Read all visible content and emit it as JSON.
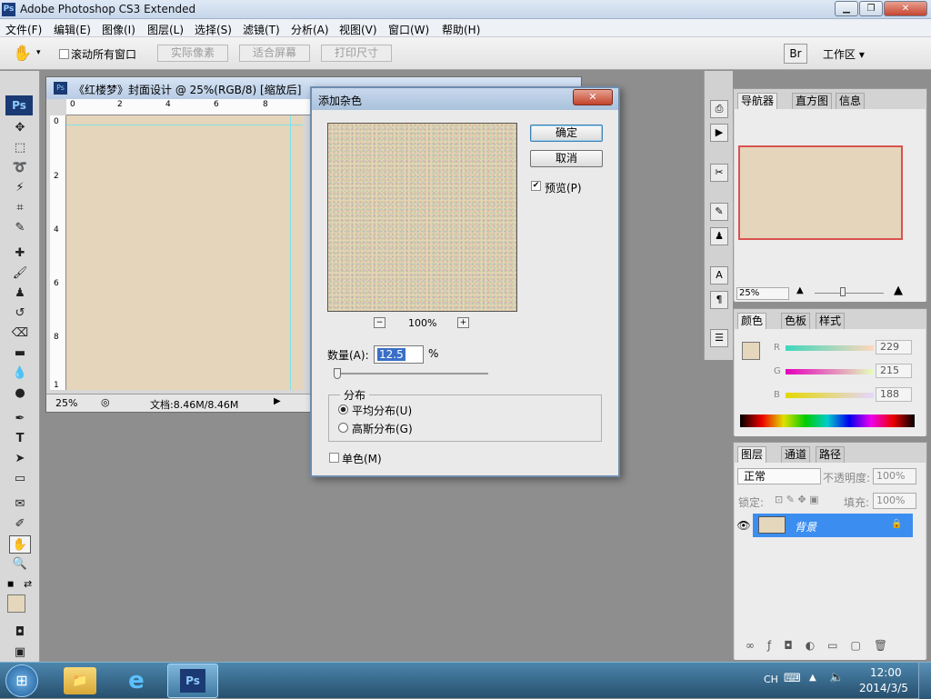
{
  "titlebar": {
    "title": "Adobe Photoshop CS3 Extended",
    "app_icon": "Ps",
    "minimize": "▁",
    "restore": "❐",
    "close": "✕"
  },
  "menu": [
    "文件(F)",
    "编辑(E)",
    "图像(I)",
    "图层(L)",
    "选择(S)",
    "滤镜(T)",
    "分析(A)",
    "视图(V)",
    "窗口(W)",
    "帮助(H)"
  ],
  "options": {
    "scroll_all": "滚动所有窗口",
    "actual_pixels": "实际像素",
    "fit_screen": "适合屏幕",
    "print_size": "打印尺寸",
    "workspace": "工作区 ▾"
  },
  "tools": {
    "ps_logo": "Ps"
  },
  "document": {
    "title": "《红楼梦》封面设计 @ 25%(RGB/8) [缩放后]",
    "h_ruler": [
      "0",
      "2",
      "4",
      "6",
      "8"
    ],
    "v_ruler": [
      "0",
      "2",
      "4",
      "6",
      "8",
      "1"
    ],
    "zoom": "25%",
    "doc_info": "文档:8.46M/8.46M",
    "canvas_color": "#e5d5bb"
  },
  "dialog": {
    "title": "添加杂色",
    "ok": "确定",
    "cancel": "取消",
    "preview_label": "预览(P)",
    "preview_checked": true,
    "zoom_out": "−",
    "zoom_level": "100%",
    "zoom_in": "+",
    "amount_label": "数量(A):",
    "amount_value": "12.5",
    "amount_unit": "%",
    "distribution_label": "分布",
    "uniform": "平均分布(U)",
    "gaussian": "高斯分布(G)",
    "selected_distribution": "uniform",
    "monochromatic": "单色(M)",
    "monochromatic_checked": false
  },
  "navigator": {
    "tabs": [
      "导航器",
      "直方图",
      "信息"
    ],
    "zoom": "25%"
  },
  "color_panel": {
    "tabs": [
      "颜色",
      "色板",
      "样式"
    ],
    "r_label": "R",
    "g_label": "G",
    "b_label": "B",
    "r_value": "229",
    "g_value": "215",
    "b_value": "188",
    "swatch": "#e5d7bc"
  },
  "layers_panel": {
    "tabs": [
      "图层",
      "通道",
      "路径"
    ],
    "blend_mode": "正常",
    "opacity_label": "不透明度:",
    "opacity_value": "100%",
    "lock_label": "锁定:",
    "fill_label": "填充:",
    "fill_value": "100%",
    "layer_name": "背景"
  },
  "taskbar": {
    "ps_label": "Ps",
    "lang": "CH",
    "time": "12:00",
    "date": "2014/3/5"
  }
}
